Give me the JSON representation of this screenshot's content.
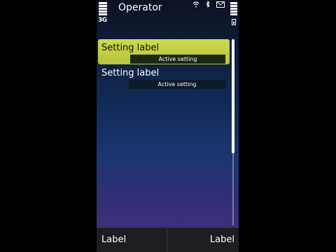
{
  "status_bar": {
    "operator": "Operator",
    "network_type": "3G",
    "icons": [
      "wifi-icon",
      "bluetooth-icon",
      "envelope-icon"
    ]
  },
  "settings_list": {
    "items": [
      {
        "label": "Setting label",
        "value": "Active setting",
        "selected": true
      },
      {
        "label": "Setting label",
        "value": "Active setting",
        "selected": false
      }
    ]
  },
  "softkeys": {
    "left": "Label",
    "right": "Label"
  },
  "colors": {
    "highlight": "#c5d145",
    "background_top": "#0d1222",
    "background_bottom": "#47327f"
  }
}
